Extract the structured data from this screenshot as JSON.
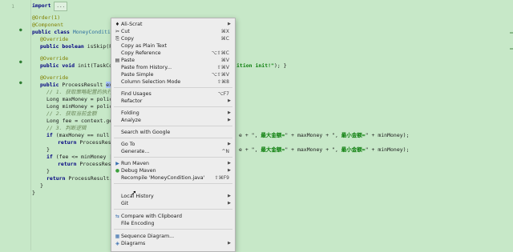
{
  "gutter": {
    "line_numbers": [
      "1",
      "",
      "",
      "",
      "",
      "",
      "",
      "",
      "",
      "",
      "",
      "",
      "",
      "",
      "",
      "",
      "",
      "",
      "",
      "",
      "",
      "",
      "",
      "",
      "",
      "",
      "",
      "",
      "",
      "",
      "",
      "",
      "",
      "",
      "",
      "",
      "",
      "",
      ""
    ]
  },
  "code": {
    "l1_import": "import",
    "l1_fold": "...",
    "l3_ann": "@Order(1)",
    "l4_ann": "@Component",
    "l5_a": "public class",
    "l5_b": " MoneyCondition ",
    "l5_c": "ext",
    "l6_ann": "@Override",
    "l7_a": "public boolean",
    "l7_b": " isSkip(Poli",
    "l9_ann": "@Override",
    "l10_a": "public void",
    "l10_b": " init(TaskConte",
    "l10_str": "ition init!\"",
    "l10_end": "); }",
    "l12_ann": "@Override",
    "l13_a": "public",
    "l13_b": " ProcessResult ",
    "l13_hl": "execut",
    "l14_cm": "// 1. 获取策略配置的执行",
    "l15": "Long maxMoney = policy",
    "l16": "Long minMoney = policy",
    "l17_cm": "// 2. 获取当前金额",
    "l18": "Long fee = context.get",
    "l19_cm": "// 3. 判断逻辑",
    "l20_a": "if",
    "l20_b": " (maxMoney == null |",
    "l21_a": "return",
    "l21_b": " ProcessResult",
    "l21_r1": "e + \", ",
    "l21_s1": "最大金额=",
    "l21_r2": "\" + maxMoney + \", ",
    "l21_s2": "最小金额=",
    "l21_r3": "\" + minMoney);",
    "l22": "}",
    "l23_a": "if",
    "l23_b": " (fee <= minMoney ||",
    "l24_a": "return",
    "l24_b": " ProcessResult",
    "l24_r1": "e + \", ",
    "l24_s1": "最大金额=",
    "l24_r2": "\" + maxMoney + \", ",
    "l24_s2": "最小金额=",
    "l24_r3": "\" + minMoney);",
    "l25": "}",
    "l26_a": "return",
    "l26_b": " ProcessResult.p",
    "l27": "}",
    "l28": "}"
  },
  "menu": {
    "items": [
      {
        "icon": "♦",
        "label": "Ali-Scrat",
        "shortcut": "",
        "submenu": true
      },
      {
        "icon": "✂",
        "label": "Cut",
        "shortcut": "⌘X",
        "submenu": false
      },
      {
        "icon": "⎘",
        "label": "Copy",
        "shortcut": "⌘C",
        "submenu": false
      },
      {
        "icon": "",
        "label": "Copy as Plain Text",
        "shortcut": "",
        "submenu": false
      },
      {
        "icon": "",
        "label": "Copy Reference",
        "shortcut": "⌥⇧⌘C",
        "submenu": false
      },
      {
        "icon": "▤",
        "label": "Paste",
        "shortcut": "⌘V",
        "submenu": false
      },
      {
        "icon": "",
        "label": "Paste from History...",
        "shortcut": "⇧⌘V",
        "submenu": false
      },
      {
        "icon": "",
        "label": "Paste Simple",
        "shortcut": "⌥⇧⌘V",
        "submenu": false
      },
      {
        "icon": "",
        "label": "Column Selection Mode",
        "shortcut": "⇧⌘8",
        "submenu": false
      },
      {
        "icon": "",
        "label": "Find Usages",
        "shortcut": "⌥F7",
        "submenu": false
      },
      {
        "icon": "",
        "label": "Refactor",
        "shortcut": "",
        "submenu": true
      },
      {
        "icon": "",
        "label": "Folding",
        "shortcut": "",
        "submenu": true
      },
      {
        "icon": "",
        "label": "Analyze",
        "shortcut": "",
        "submenu": true
      },
      {
        "icon": "",
        "label": "Search with Google",
        "shortcut": "",
        "submenu": false
      },
      {
        "icon": "",
        "label": "Go To",
        "shortcut": "",
        "submenu": true
      },
      {
        "icon": "",
        "label": "Generate...",
        "shortcut": "^N",
        "submenu": false
      },
      {
        "icon": "▶",
        "label": "Run Maven",
        "shortcut": "",
        "submenu": true
      },
      {
        "icon": "●",
        "label": "Debug Maven",
        "shortcut": "",
        "submenu": true
      },
      {
        "icon": "",
        "label": "Recompile 'MoneyCondition.java'",
        "shortcut": "⇧⌘F9",
        "submenu": false
      },
      {
        "icon": "",
        "label": "Local History",
        "shortcut": "",
        "submenu": true
      },
      {
        "icon": "",
        "label": "Git",
        "shortcut": "",
        "submenu": true
      },
      {
        "icon": "⇆",
        "label": "Compare with Clipboard",
        "shortcut": "",
        "submenu": false
      },
      {
        "icon": "",
        "label": "File Encoding",
        "shortcut": "",
        "submenu": false
      },
      {
        "icon": "▦",
        "label": "Sequence Diagram...",
        "shortcut": "",
        "submenu": false
      },
      {
        "icon": "◈",
        "label": "Diagrams",
        "shortcut": "",
        "submenu": true
      }
    ]
  },
  "colors": {
    "editor_bg": "#c7e8c8",
    "menu_bg": "#ededed",
    "keyword": "#000080",
    "annotation": "#808000",
    "string": "#0a7d0a",
    "selection": "#a9c7ff"
  }
}
